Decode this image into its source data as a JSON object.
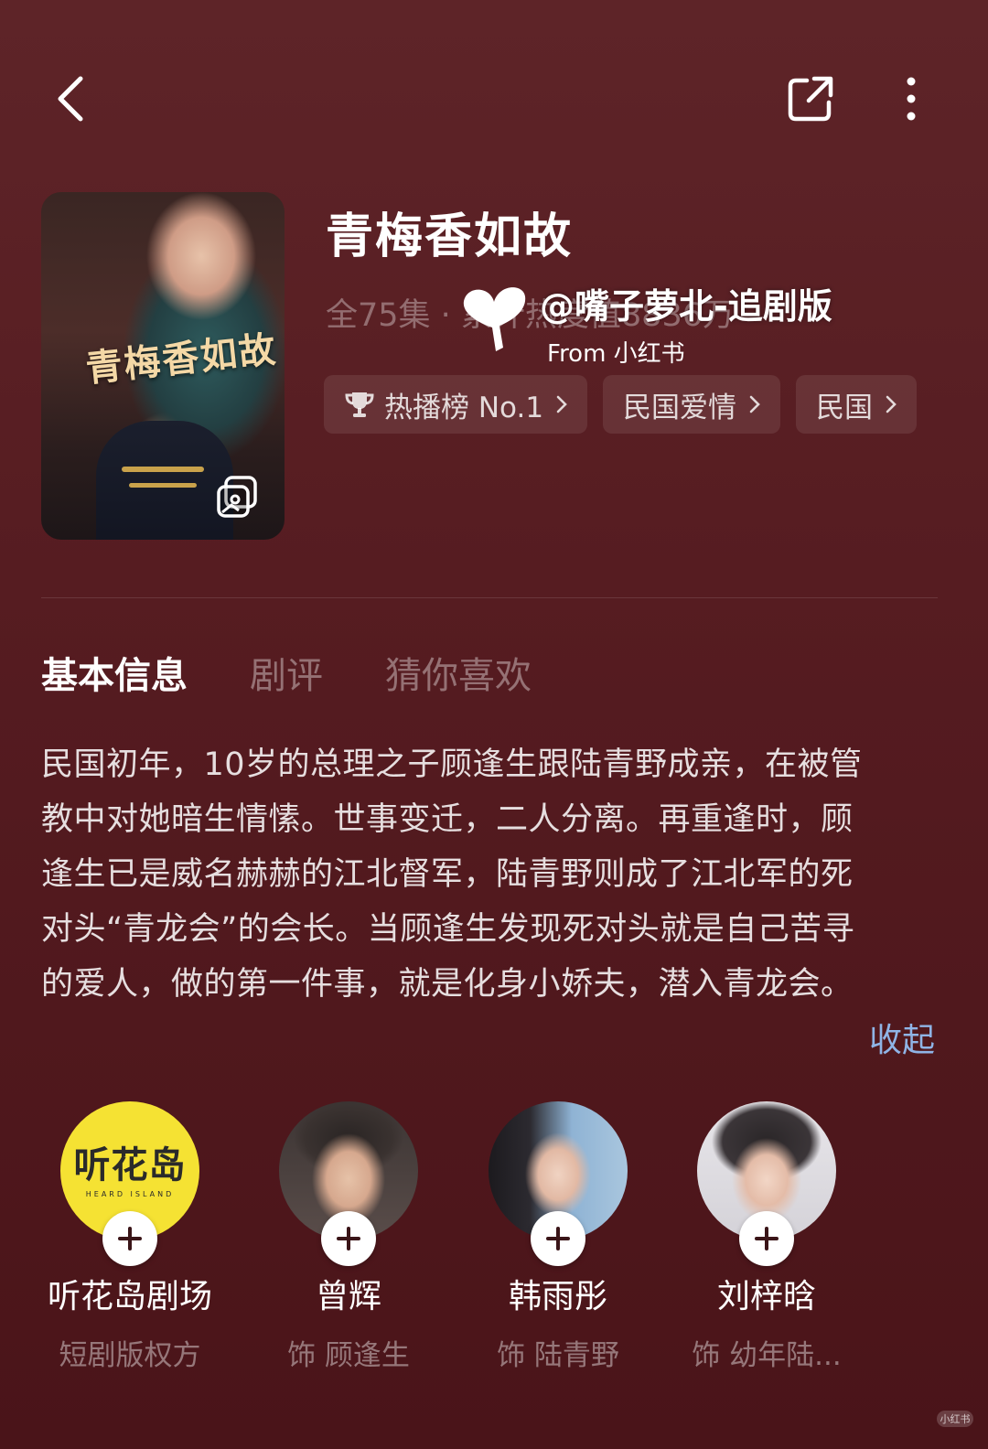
{
  "drama": {
    "title": "青梅香如故",
    "poster_title": "青梅香如故",
    "meta": "全75集 · 累计热度值8836万"
  },
  "watermark": {
    "handle": "@嘴子萝北-追剧版",
    "from": "From 小红书",
    "corner": "小红书"
  },
  "tags": [
    {
      "label": "热播榜 No.1",
      "icon": "trophy-icon"
    },
    {
      "label": "民国爱情"
    },
    {
      "label": "民国"
    }
  ],
  "tabs": [
    {
      "label": "基本信息",
      "active": true
    },
    {
      "label": "剧评",
      "active": false
    },
    {
      "label": "猜你喜欢",
      "active": false
    }
  ],
  "synopsis": {
    "lines": [
      "民国初年，10岁的总理之子顾逢生跟陆青野成亲，在被管",
      "教中对她暗生情愫。世事变迁，二人分离。再重逢时，顾",
      "逢生已是威名赫赫的江北督军，陆青野则成了江北军的死",
      "对头“青龙会”的会长。当顾逢生发现死对头就是自己苦寻",
      "的爱人，做的第一件事，就是化身小娇夫，潜入青龙会。"
    ],
    "collapse_label": "收起"
  },
  "cast": [
    {
      "name": "听花岛剧场",
      "role": "短剧版权方",
      "logo_text": "听花岛",
      "logo_sub": "HEARD ISLAND"
    },
    {
      "name": "曾辉",
      "role": "饰 顾逢生"
    },
    {
      "name": "韩雨彤",
      "role": "饰 陆青野"
    },
    {
      "name": "刘梓晗",
      "role": "饰 幼年陆..."
    }
  ],
  "colors": {
    "background": "#561c21",
    "accent_link": "#8fb4e6",
    "logo_yellow": "#f5e233"
  }
}
